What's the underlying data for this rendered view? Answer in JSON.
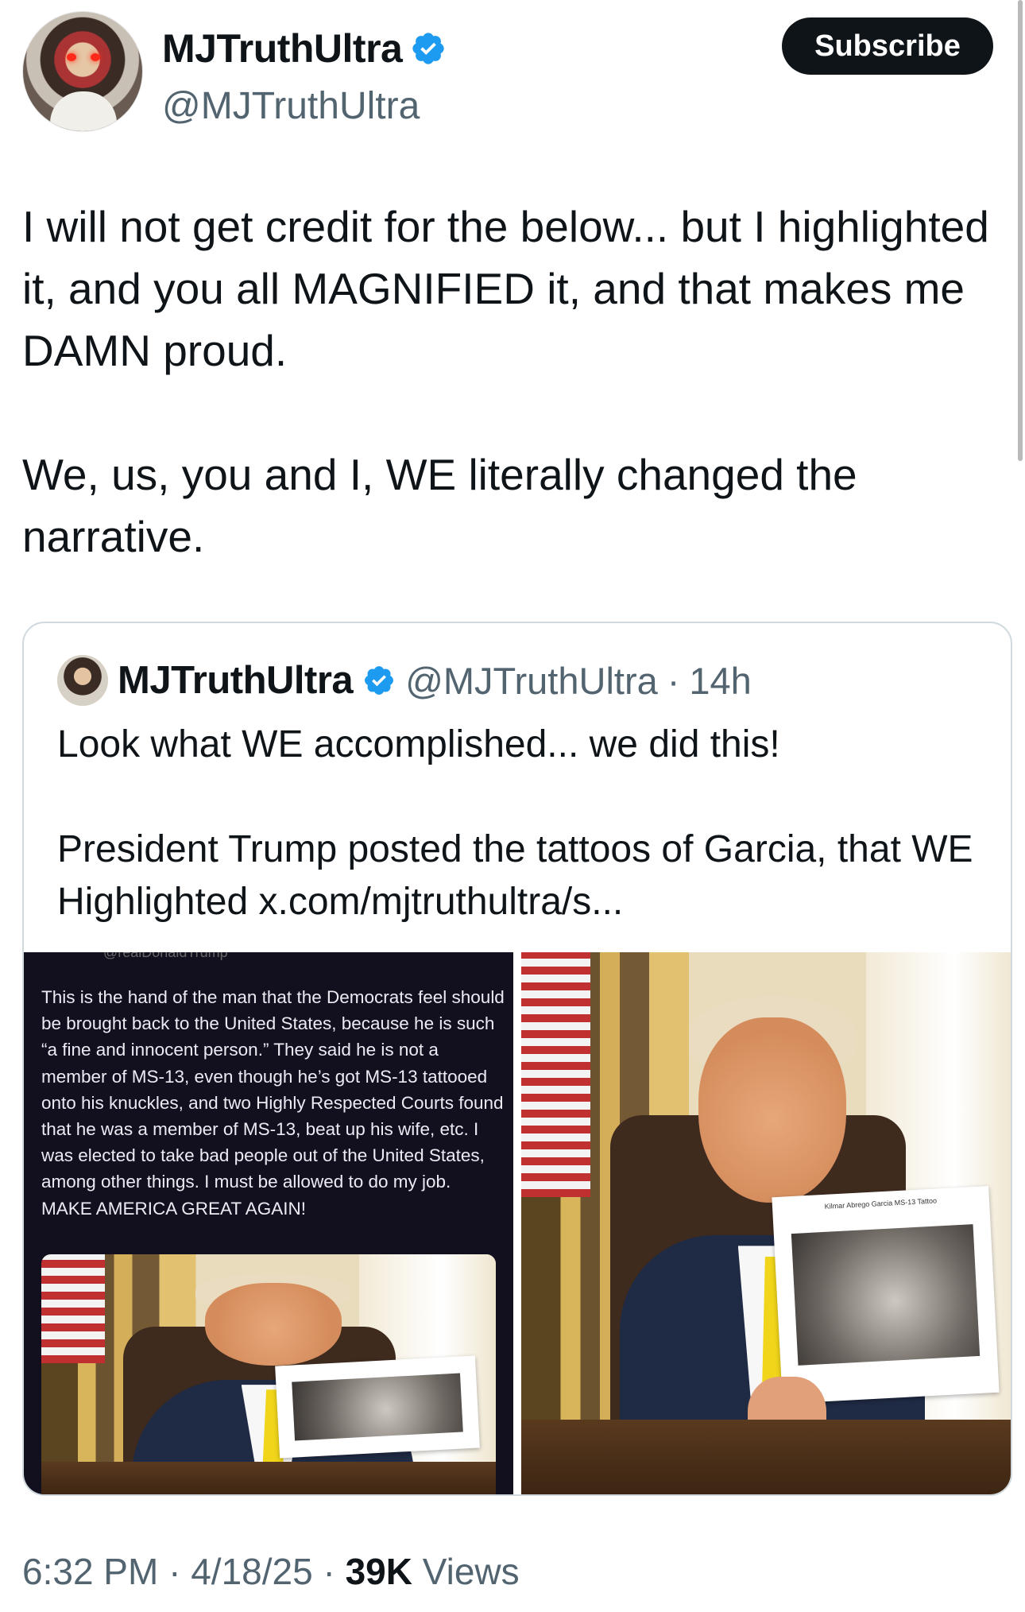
{
  "author": {
    "name": "MJTruthUltra",
    "handle": "@MJTruthUltra",
    "verified": true,
    "verified_color": "#1d9bf0"
  },
  "subscribe_label": "Subscribe",
  "tweet": {
    "paragraphs": [
      "I will not get credit for the below... but I highlighted it, and you all MAGNIFIED it, and that makes me DAMN proud.",
      "We, us, you and I, WE literally changed the narrative."
    ]
  },
  "quote": {
    "name": "MJTruthUltra",
    "handle": "@MJTruthUltra",
    "separator": "·",
    "time": "14h",
    "paragraphs": [
      "Look what WE accomplished... we did this!",
      "President Trump posted the tattoos of Garcia, that WE Highlighted x.com/mjtruthultra/s..."
    ],
    "media": {
      "left_top_handle": "@realDonaldTrump",
      "left_text": "This is the hand of the man that the Democrats feel should be brought back to the United States, because he is such “a fine and innocent person.” They said he is not a member of MS-13, even though he’s got MS-13 tattooed onto his knuckles, and two Highly Respected Courts found that he was a member of MS-13, beat up his wife, etc. I was elected to take bad people out of the United States, among other things. I must be allowed to do my job. MAKE AMERICA GREAT AGAIN!",
      "paper_caption": "Kilmar Abrego Garcia MS-13 Tattoo"
    }
  },
  "footer": {
    "time": "6:32 PM",
    "sep1": " · ",
    "date": "4/18/25",
    "sep2": " · ",
    "views_count": "39K",
    "views_label": " Views"
  },
  "colors": {
    "text": "#0f1419",
    "secondary": "#536471",
    "border": "#cfd9de",
    "button_bg": "#0f1419"
  }
}
